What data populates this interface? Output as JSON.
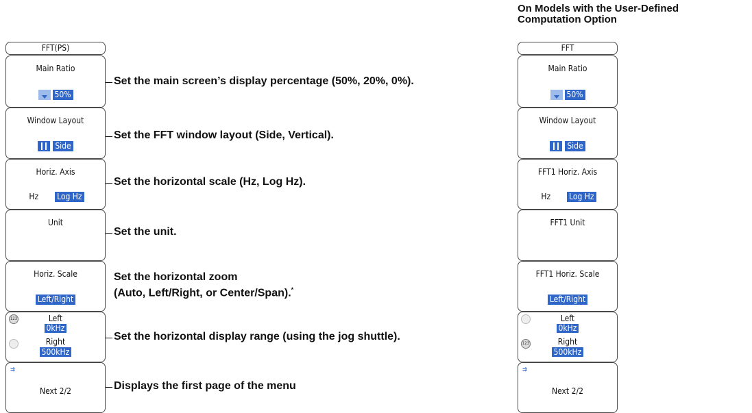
{
  "heading": {
    "line1": "On Models with the User-Defined",
    "line2": "Computation Option"
  },
  "left_menu": {
    "title": "FFT(PS)",
    "main_ratio": {
      "label": "Main Ratio",
      "value": "50%"
    },
    "window_layout": {
      "label": "Window Layout",
      "value": "Side"
    },
    "horiz_axis": {
      "label": "Horiz. Axis",
      "option1": "Hz",
      "option2": "Log Hz"
    },
    "unit": {
      "label": "Unit"
    },
    "horiz_scale": {
      "label": "Horiz. Scale",
      "value": "Left/Right"
    },
    "range": {
      "left_label": "Left",
      "left_value": "0kHz",
      "right_label": "Right",
      "right_value": "500kHz"
    },
    "next": {
      "label": "Next 2/2"
    }
  },
  "right_menu": {
    "title": "FFT",
    "main_ratio": {
      "label": "Main Ratio",
      "value": "50%"
    },
    "window_layout": {
      "label": "Window Layout",
      "value": "Side"
    },
    "horiz_axis": {
      "label": "FFT1 Horiz. Axis",
      "option1": "Hz",
      "option2": "Log Hz"
    },
    "unit": {
      "label": "FFT1 Unit"
    },
    "horiz_scale": {
      "label": "FFT1 Horiz. Scale",
      "value": "Left/Right"
    },
    "range": {
      "left_label": "Left",
      "left_value": "0kHz",
      "right_label": "Right",
      "right_value": "500kHz"
    },
    "next": {
      "label": "Next 2/2"
    }
  },
  "descriptions": {
    "main_ratio": "Set the main screen’s display percentage (50%, 20%, 0%).",
    "window_layout": "Set the FFT window layout (Side, Vertical).",
    "horiz_axis": "Set the horizontal scale (Hz, Log Hz).",
    "unit": "Set the unit.",
    "horiz_zoom_line1": "Set the horizontal zoom",
    "horiz_zoom_line2": "(Auto, Left/Right, or Center/Span).",
    "horiz_zoom_note": "*",
    "range": "Set the horizontal display range (using the jog shuttle).",
    "next": "Displays the first page of the menu"
  },
  "colors": {
    "highlight": "#2f66c8",
    "border": "#4a4a4a"
  },
  "icons": {
    "ratio": "main-ratio-icon",
    "layout": "side-layout-icon",
    "jog": "jog-shuttle-icon",
    "next_page": "next-page-icon"
  }
}
